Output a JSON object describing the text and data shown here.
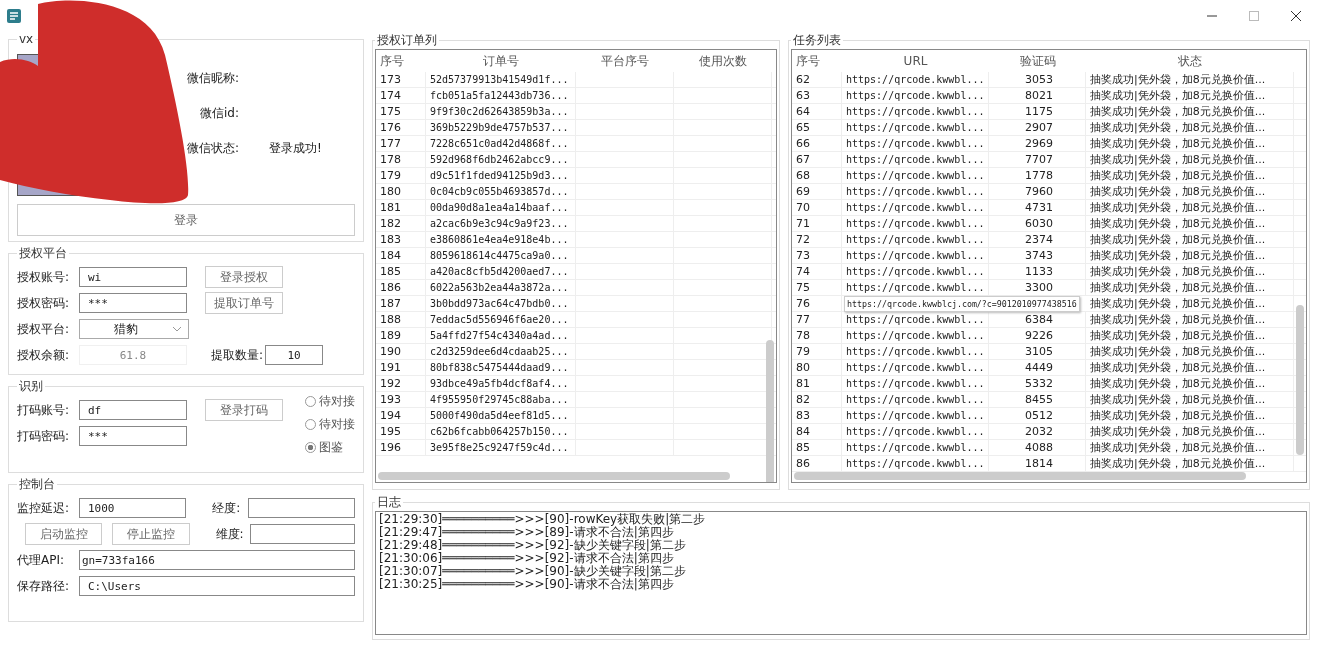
{
  "wechat_login": {
    "title": "vx",
    "fields": [
      {
        "label": "微信昵称:"
      },
      {
        "label": "微信id:"
      },
      {
        "label": "微信状态:",
        "value": "登录成功!"
      }
    ],
    "login_button": "登录"
  },
  "auth_platform": {
    "title": "授权平台",
    "account": {
      "label": "授权账号:",
      "value": "wi"
    },
    "password": {
      "label": "授权密码:",
      "value": "***"
    },
    "platform": {
      "label": "授权平台:",
      "value": "猎豹"
    },
    "balance": {
      "label": "授权余额:",
      "value": "61.8",
      "disabled": true
    },
    "fetch_count": {
      "label": "提取数量:",
      "value": "10"
    },
    "buttons": [
      "登录授权",
      "提取订单号"
    ]
  },
  "recognition": {
    "title": "识别",
    "account": {
      "label": "打码账号:",
      "value": "df"
    },
    "password": {
      "label": "打码密码:",
      "value": "***"
    },
    "login_button": "登录打码",
    "options": [
      {
        "label": "待对接",
        "selected": false
      },
      {
        "label": "待对接",
        "selected": false
      },
      {
        "label": "图鉴",
        "selected": true
      }
    ]
  },
  "console": {
    "title": "控制台",
    "delay": {
      "label": "监控延迟:",
      "value": "1000"
    },
    "longitude": {
      "label": "经度:"
    },
    "latitude": {
      "label": "维度:"
    },
    "start_button": "启动监控",
    "stop_button": "停止监控",
    "proxy_api": {
      "label": "代理API:",
      "value": "gn=733fa166"
    },
    "save_path": {
      "label": "保存路径:",
      "value": "C:\\Users"
    }
  },
  "order_list": {
    "title": "授权订单列",
    "columns": [
      "序号",
      "订单号",
      "平台序号",
      "使用次数"
    ],
    "rows": [
      {
        "index": "173",
        "order": "52d57379913b41549d1f..."
      },
      {
        "index": "174",
        "order": "fcb051a5fa12443db736..."
      },
      {
        "index": "175",
        "order": "9f9f30c2d62643859b3a..."
      },
      {
        "index": "176",
        "order": "369b5229b9de4757b537..."
      },
      {
        "index": "177",
        "order": "7228c651c0ad42d4868f..."
      },
      {
        "index": "178",
        "order": "592d968f6db2462abcc9..."
      },
      {
        "index": "179",
        "order": "d9c51f1fded94125b9d3..."
      },
      {
        "index": "180",
        "order": "0c04cb9c055b4693857d..."
      },
      {
        "index": "181",
        "order": "00da90d8a1ea4a14baaf..."
      },
      {
        "index": "182",
        "order": "a2cac6b9e3c94c9a9f23..."
      },
      {
        "index": "183",
        "order": "e3860861e4ea4e918e4b..."
      },
      {
        "index": "184",
        "order": "8059618614c4475ca9a0..."
      },
      {
        "index": "185",
        "order": "a420ac8cfb5d4200aed7..."
      },
      {
        "index": "186",
        "order": "6022a563b2ea44a3872a..."
      },
      {
        "index": "187",
        "order": "3b0bdd973ac64c47bdb0..."
      },
      {
        "index": "188",
        "order": "7eddac5d556946f6ae20..."
      },
      {
        "index": "189",
        "order": "5a4ffd27f54c4340a4ad..."
      },
      {
        "index": "190",
        "order": "c2d3259dee6d4cdaab25..."
      },
      {
        "index": "191",
        "order": "80bf838c5475444daad9..."
      },
      {
        "index": "192",
        "order": "93dbce49a5fb4dcf8af4..."
      },
      {
        "index": "193",
        "order": "4f955950f29745c88aba..."
      },
      {
        "index": "194",
        "order": "5000f490da5d4eef81d5..."
      },
      {
        "index": "195",
        "order": "c62b6fcabb064257b150..."
      },
      {
        "index": "196",
        "order": "3e95f8e25c9247f59c4d..."
      }
    ]
  },
  "task_list": {
    "title": "任务列表",
    "columns": [
      "序号",
      "URL",
      "验证码",
      "状态"
    ],
    "rows": [
      {
        "index": "62",
        "url": "https://qrcode.kwwbl...",
        "code": "3053",
        "status": "抽奖成功|凭外袋，加8元兑换价值..."
      },
      {
        "index": "63",
        "url": "https://qrcode.kwwbl...",
        "code": "8021",
        "status": "抽奖成功|凭外袋，加8元兑换价值..."
      },
      {
        "index": "64",
        "url": "https://qrcode.kwwbl...",
        "code": "1175",
        "status": "抽奖成功|凭外袋，加8元兑换价值..."
      },
      {
        "index": "65",
        "url": "https://qrcode.kwwbl...",
        "code": "2907",
        "status": "抽奖成功|凭外袋，加8元兑换价值..."
      },
      {
        "index": "66",
        "url": "https://qrcode.kwwbl...",
        "code": "2969",
        "status": "抽奖成功|凭外袋，加8元兑换价值..."
      },
      {
        "index": "67",
        "url": "https://qrcode.kwwbl...",
        "code": "7707",
        "status": "抽奖成功|凭外袋，加8元兑换价值..."
      },
      {
        "index": "68",
        "url": "https://qrcode.kwwbl...",
        "code": "1778",
        "status": "抽奖成功|凭外袋，加8元兑换价值..."
      },
      {
        "index": "69",
        "url": "https://qrcode.kwwbl...",
        "code": "7960",
        "status": "抽奖成功|凭外袋，加8元兑换价值..."
      },
      {
        "index": "70",
        "url": "https://qrcode.kwwbl...",
        "code": "4731",
        "status": "抽奖成功|凭外袋，加8元兑换价值..."
      },
      {
        "index": "71",
        "url": "https://qrcode.kwwbl...",
        "code": "6030",
        "status": "抽奖成功|凭外袋，加8元兑换价值..."
      },
      {
        "index": "72",
        "url": "https://qrcode.kwwbl...",
        "code": "2374",
        "status": "抽奖成功|凭外袋，加8元兑换价值..."
      },
      {
        "index": "73",
        "url": "https://qrcode.kwwbl...",
        "code": "3743",
        "status": "抽奖成功|凭外袋，加8元兑换价值..."
      },
      {
        "index": "74",
        "url": "https://qrcode.kwwbl...",
        "code": "1133",
        "status": "抽奖成功|凭外袋，加8元兑换价值..."
      },
      {
        "index": "75",
        "url": "https://qrcode.kwwbl...",
        "code": "3300",
        "status": "抽奖成功|凭外袋，加8元兑换价值..."
      },
      {
        "index": "76",
        "tooltip": "https://qrcode.kwwblcj.com/?c=9012010977438516",
        "status": "抽奖成功|凭外袋，加8元兑换价值..."
      },
      {
        "index": "77",
        "url": "https://qrcode.kwwbl...",
        "code": "6384",
        "status": "抽奖成功|凭外袋，加8元兑换价值..."
      },
      {
        "index": "78",
        "url": "https://qrcode.kwwbl...",
        "code": "9226",
        "status": "抽奖成功|凭外袋，加8元兑换价值..."
      },
      {
        "index": "79",
        "url": "https://qrcode.kwwbl...",
        "code": "3105",
        "status": "抽奖成功|凭外袋，加8元兑换价值..."
      },
      {
        "index": "80",
        "url": "https://qrcode.kwwbl...",
        "code": "4449",
        "status": "抽奖成功|凭外袋，加8元兑换价值..."
      },
      {
        "index": "81",
        "url": "https://qrcode.kwwbl...",
        "code": "5332",
        "status": "抽奖成功|凭外袋，加8元兑换价值..."
      },
      {
        "index": "82",
        "url": "https://qrcode.kwwbl...",
        "code": "8455",
        "status": "抽奖成功|凭外袋，加8元兑换价值..."
      },
      {
        "index": "83",
        "url": "https://qrcode.kwwbl...",
        "code": "0512",
        "status": "抽奖成功|凭外袋，加8元兑换价值..."
      },
      {
        "index": "84",
        "url": "https://qrcode.kwwbl...",
        "code": "2032",
        "status": "抽奖成功|凭外袋，加8元兑换价值..."
      },
      {
        "index": "85",
        "url": "https://qrcode.kwwbl...",
        "code": "4088",
        "status": "抽奖成功|凭外袋，加8元兑换价值..."
      },
      {
        "index": "86",
        "url": "https://qrcode.kwwbl...",
        "code": "1814",
        "status": "抽奖成功|凭外袋，加8元兑换价值..."
      }
    ]
  },
  "log": {
    "title": "日志",
    "lines": [
      "[21:29:30]══════════>>>[90]-rowKey获取失败|第二步",
      "[21:29:47]══════════>>>[89]-请求不合法|第四步",
      "[21:29:48]══════════>>>[92]-缺少关键字段|第二步",
      "[21:30:06]══════════>>>[92]-请求不合法|第四步",
      "[21:30:07]══════════>>>[90]-缺少关键字段|第二步",
      "[21:30:25]══════════>>>[90]-请求不合法|第四步"
    ]
  }
}
